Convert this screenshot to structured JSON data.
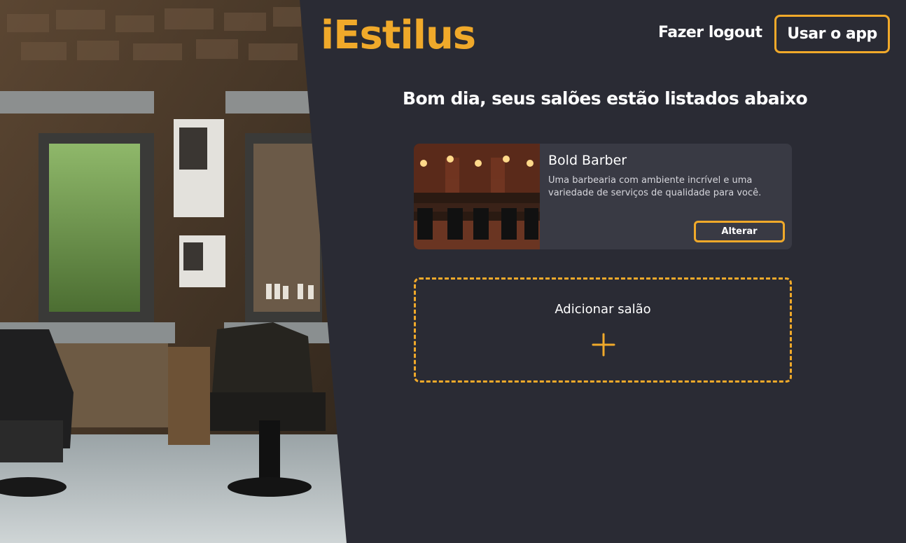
{
  "header": {
    "brand": "iEstilus",
    "logout_label": "Fazer logout",
    "app_button_label": "Usar o app"
  },
  "main": {
    "greeting": "Bom dia, seus salões estão listados abaixo",
    "salons": [
      {
        "name": "Bold Barber",
        "description": "Uma barbearia com ambiente incrível e uma variedade de serviços de qualidade para você.",
        "edit_label": "Alterar"
      }
    ],
    "add_salon_label": "Adicionar salão"
  },
  "icons": {
    "add": "plus-icon"
  },
  "colors": {
    "accent": "#f0a92a",
    "background": "#2a2b34",
    "card": "#393a44"
  }
}
